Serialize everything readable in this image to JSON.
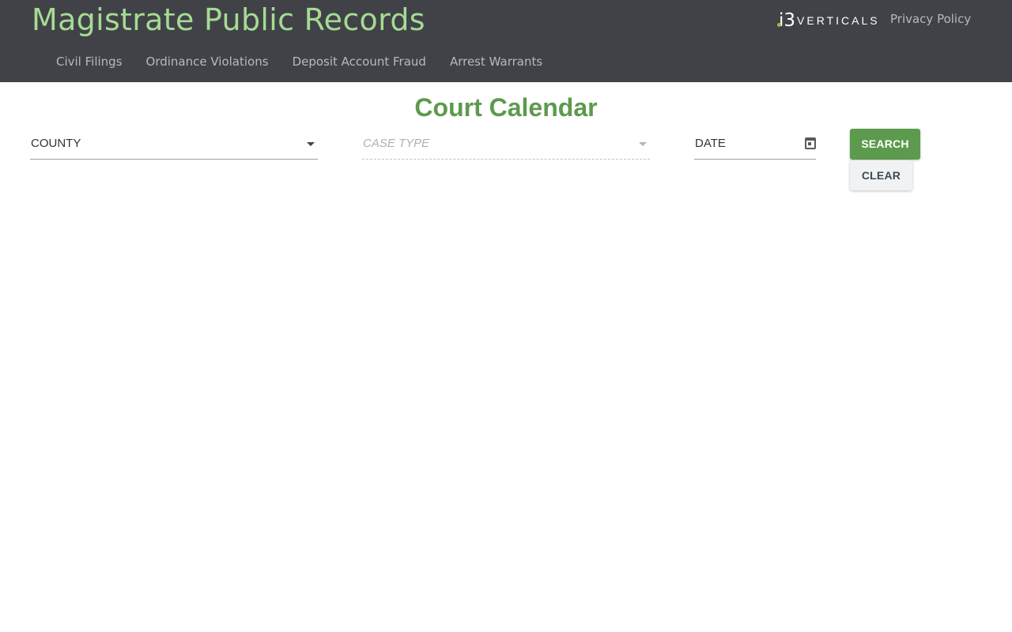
{
  "header": {
    "site_title": "Magistrate Public Records",
    "nav": [
      {
        "label": "Civil Filings"
      },
      {
        "label": "Ordinance Violations"
      },
      {
        "label": "Deposit Account Fraud"
      },
      {
        "label": "Arrest Warrants"
      }
    ],
    "brand": {
      "mark": "i3",
      "text": "VERTICALS"
    },
    "privacy_label": "Privacy Policy"
  },
  "main": {
    "heading": "Court Calendar",
    "filters": {
      "county_label": "COUNTY",
      "case_type_label": "CASE TYPE",
      "date_label": "DATE"
    },
    "buttons": {
      "search_label": "SEARCH",
      "clear_label": "CLEAR"
    }
  },
  "colors": {
    "header_bg": "#414247",
    "title_green": "#a5db93",
    "accent_green": "#5c9a4d",
    "nav_text": "#b7b9bd"
  },
  "icons": {
    "county_dropdown": "caret-down-icon",
    "case_type_dropdown": "caret-down-icon",
    "date_picker": "calendar-icon"
  }
}
